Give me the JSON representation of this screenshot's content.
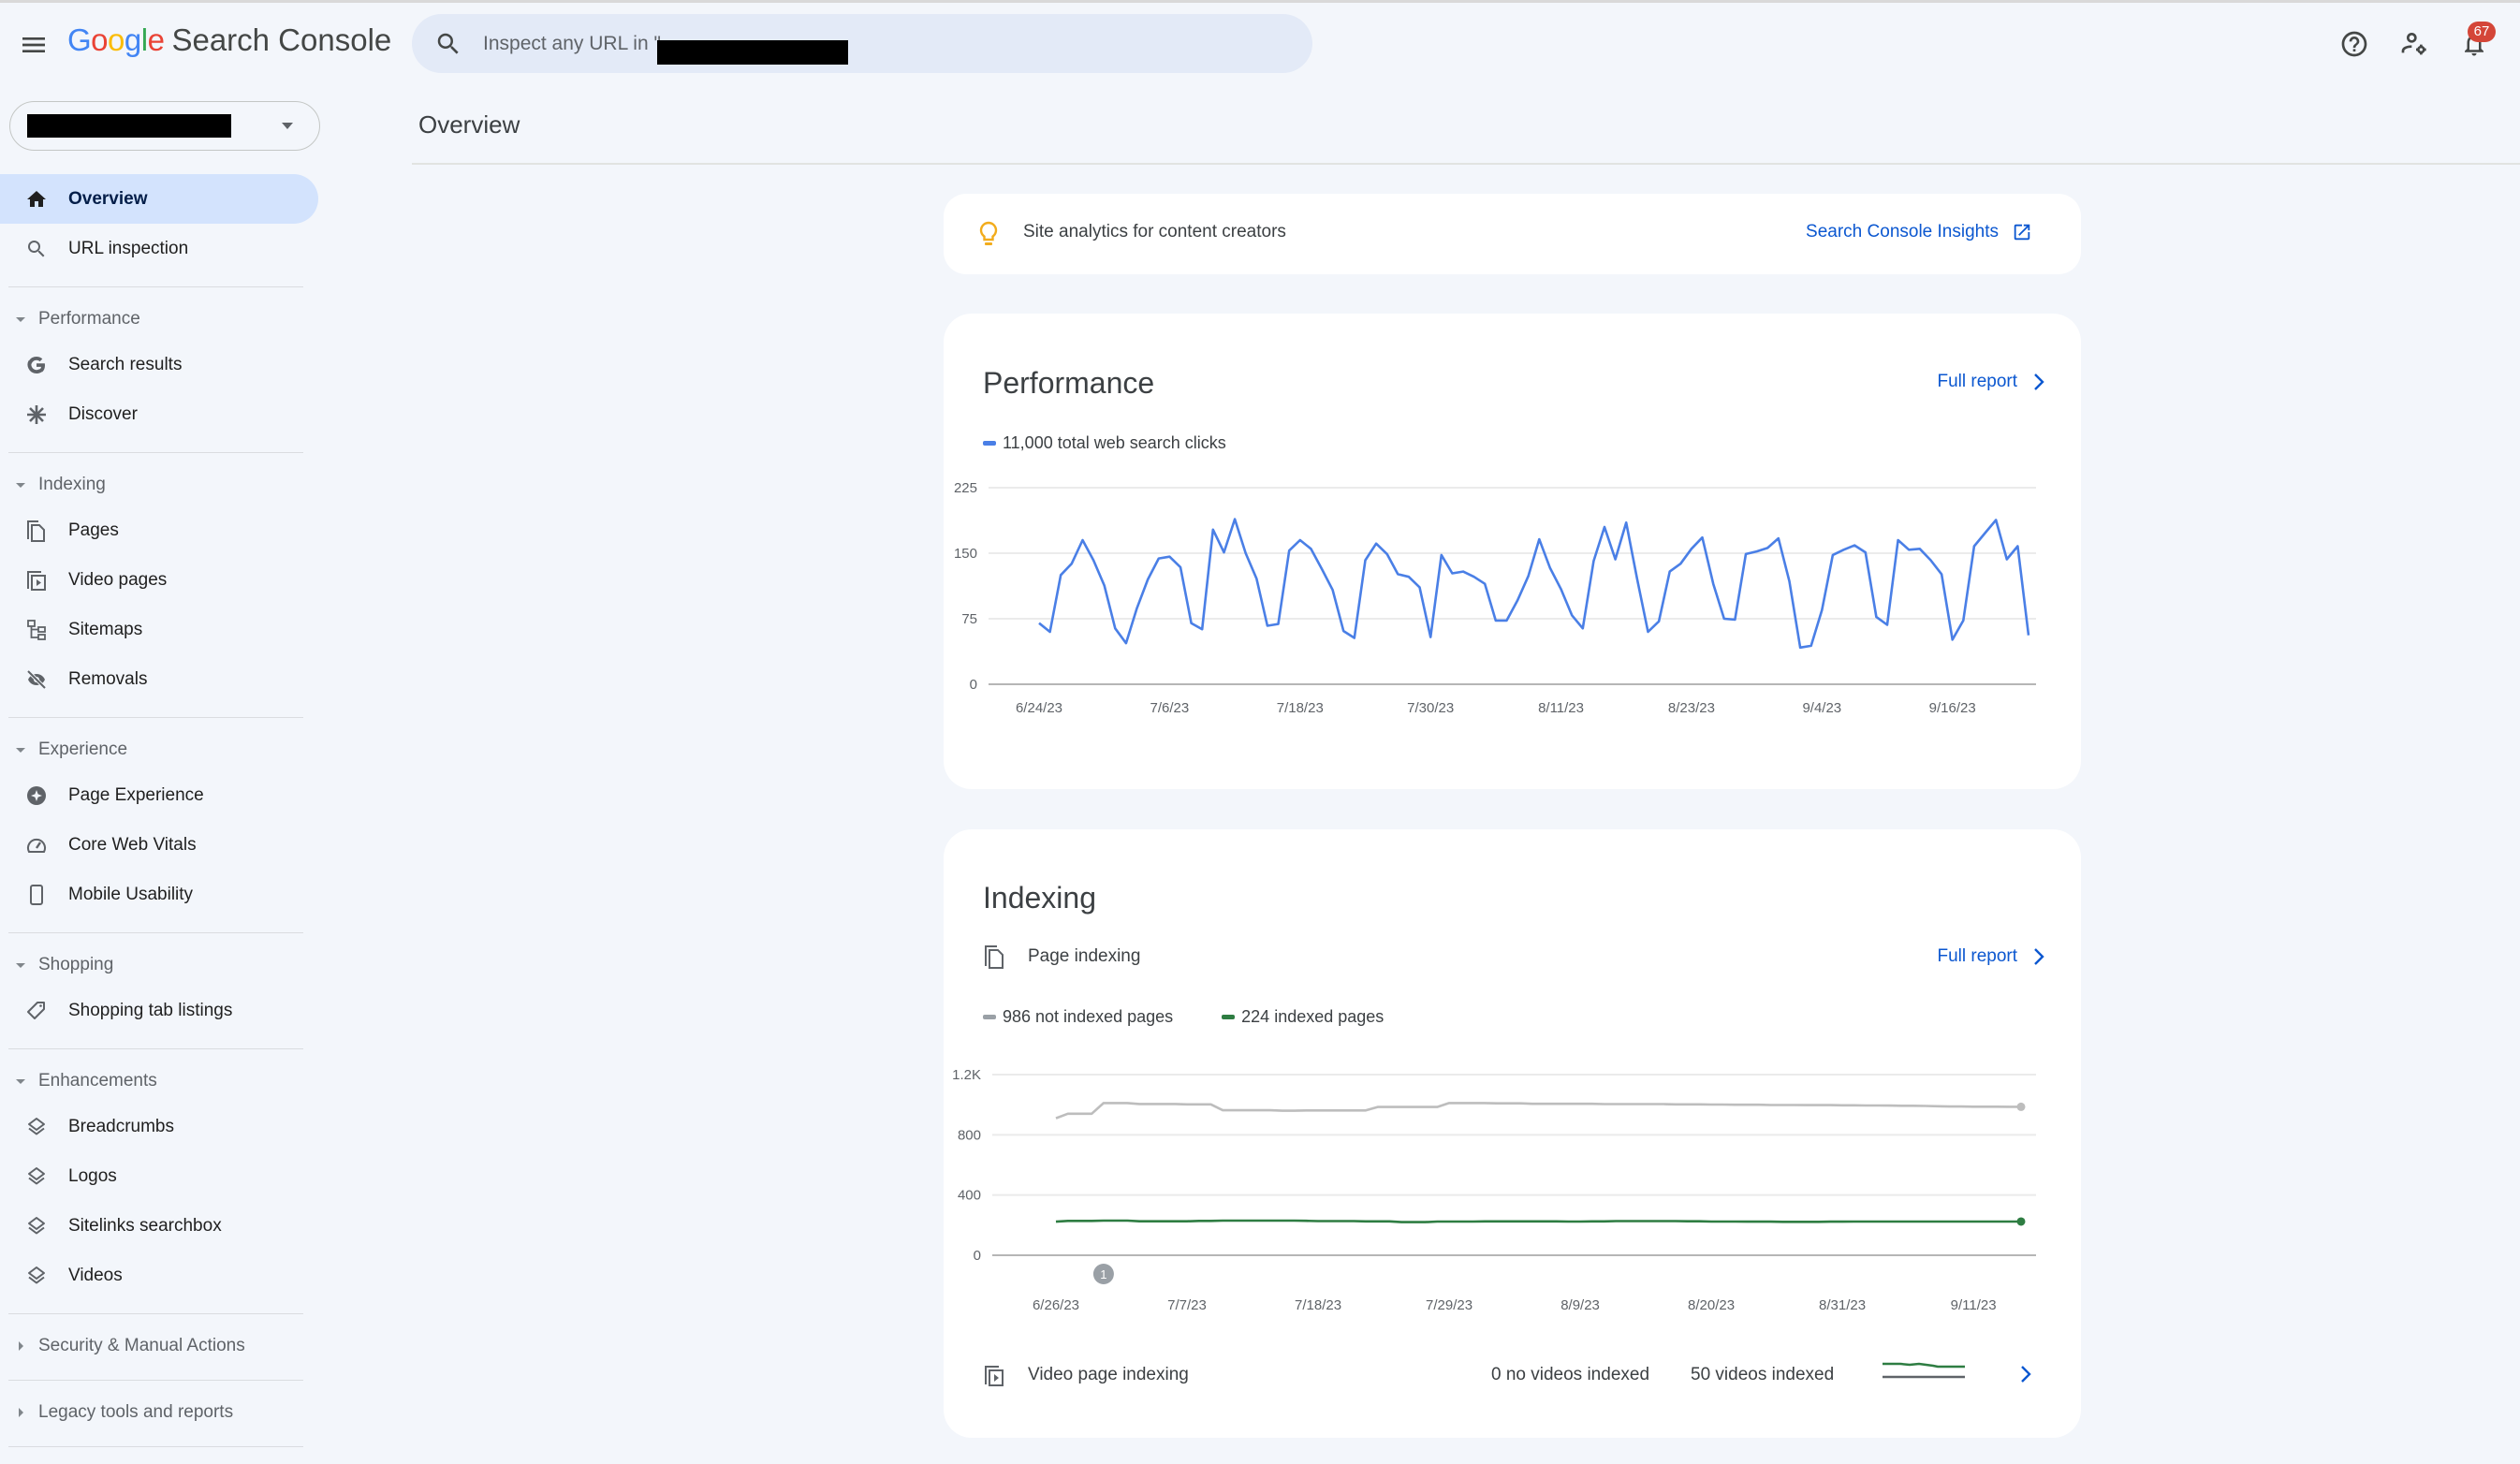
{
  "app": {
    "logo_google": [
      "G",
      "o",
      "o",
      "g",
      "l",
      "e"
    ],
    "logo_colors": [
      "#4285f4",
      "#ea4335",
      "#fbbc05",
      "#4285f4",
      "#34a853",
      "#ea4335"
    ],
    "product_name": "Search Console",
    "search_placeholder": "Inspect any URL in \"",
    "notification_count": "67",
    "accent_color": "#0b57d0"
  },
  "page": {
    "title": "Overview"
  },
  "sidebar": {
    "top_items": [
      {
        "label": "Overview",
        "icon": "home-icon",
        "active": true
      },
      {
        "label": "URL inspection",
        "icon": "search-icon",
        "active": false
      }
    ],
    "sections": [
      {
        "label": "Performance",
        "expanded": true,
        "items": [
          {
            "label": "Search results",
            "icon": "google-g-icon"
          },
          {
            "label": "Discover",
            "icon": "asterisk-icon"
          }
        ]
      },
      {
        "label": "Indexing",
        "expanded": true,
        "items": [
          {
            "label": "Pages",
            "icon": "pages-icon"
          },
          {
            "label": "Video pages",
            "icon": "video-pages-icon"
          },
          {
            "label": "Sitemaps",
            "icon": "sitemap-icon"
          },
          {
            "label": "Removals",
            "icon": "eye-off-icon"
          }
        ]
      },
      {
        "label": "Experience",
        "expanded": true,
        "items": [
          {
            "label": "Page Experience",
            "icon": "page-experience-icon"
          },
          {
            "label": "Core Web Vitals",
            "icon": "gauge-icon"
          },
          {
            "label": "Mobile Usability",
            "icon": "smartphone-icon"
          }
        ]
      },
      {
        "label": "Shopping",
        "expanded": true,
        "items": [
          {
            "label": "Shopping tab listings",
            "icon": "tag-icon"
          }
        ]
      },
      {
        "label": "Enhancements",
        "expanded": true,
        "items": [
          {
            "label": "Breadcrumbs",
            "icon": "layers-icon"
          },
          {
            "label": "Logos",
            "icon": "layers-icon"
          },
          {
            "label": "Sitelinks searchbox",
            "icon": "layers-icon"
          },
          {
            "label": "Videos",
            "icon": "layers-icon"
          }
        ]
      },
      {
        "label": "Security & Manual Actions",
        "expanded": false,
        "items": []
      },
      {
        "label": "Legacy tools and reports",
        "expanded": false,
        "items": []
      }
    ]
  },
  "insights": {
    "text": "Site analytics for content creators",
    "link_label": "Search Console Insights"
  },
  "performance": {
    "title": "Performance",
    "full_report_label": "Full report",
    "legend": "11,000 total web search clicks"
  },
  "indexing": {
    "title": "Indexing",
    "page_indexing_label": "Page indexing",
    "full_report_label": "Full report",
    "legend_not_indexed": "986 not indexed pages",
    "legend_indexed": "224 indexed pages",
    "annotation_label": "1",
    "video_label": "Video page indexing",
    "video_no_indexed": "0 no videos indexed",
    "video_indexed": "50 videos indexed"
  },
  "chart_data": [
    {
      "type": "line",
      "title": "Performance",
      "legend": [
        "11,000 total web search clicks"
      ],
      "series_color": "#4a7fe6",
      "ylim": [
        0,
        225
      ],
      "yticks": [
        0,
        75,
        150,
        225
      ],
      "ytick_labels": [
        "0",
        "75",
        "150",
        "225"
      ],
      "start_date": "6/24/23",
      "xtick_labels": [
        "6/24/23",
        "7/6/23",
        "7/18/23",
        "7/30/23",
        "8/11/23",
        "8/23/23",
        "9/4/23",
        "9/16/23"
      ],
      "xtick_day_index": [
        0,
        12,
        24,
        36,
        48,
        60,
        72,
        84
      ],
      "grid": true,
      "series": [
        {
          "name": "Clicks",
          "values": [
            70,
            60,
            125,
            138,
            165,
            142,
            113,
            64,
            47,
            87,
            120,
            144,
            146,
            134,
            70,
            63,
            177,
            151,
            189,
            150,
            121,
            67,
            69,
            153,
            165,
            155,
            132,
            108,
            61,
            53,
            142,
            161,
            149,
            126,
            123,
            111,
            54,
            148,
            127,
            129,
            123,
            115,
            73,
            73,
            96,
            124,
            166,
            133,
            109,
            79,
            64,
            141,
            180,
            143,
            185,
            121,
            60,
            72,
            129,
            138,
            155,
            168,
            115,
            75,
            74,
            149,
            152,
            156,
            167,
            118,
            42,
            44,
            85,
            148,
            154,
            159,
            151,
            77,
            68,
            165,
            154,
            155,
            142,
            126,
            51,
            73,
            158,
            173,
            188,
            143,
            158,
            56
          ]
        }
      ]
    },
    {
      "type": "line",
      "title": "Page indexing",
      "legend": [
        "986 not indexed pages",
        "224 indexed pages"
      ],
      "ylim": [
        0,
        1200
      ],
      "yticks": [
        0,
        400,
        800,
        1200
      ],
      "ytick_labels": [
        "0",
        "400",
        "800",
        "1.2K"
      ],
      "start_date": "6/26/23",
      "xtick_labels": [
        "6/26/23",
        "7/7/23",
        "7/18/23",
        "7/29/23",
        "8/9/23",
        "8/20/23",
        "8/31/23",
        "9/11/23"
      ],
      "xtick_day_index": [
        0,
        11,
        22,
        33,
        44,
        55,
        66,
        77
      ],
      "annotations": [
        {
          "day_index": 4,
          "label": "1"
        }
      ],
      "grid": true,
      "series": [
        {
          "name": "Not indexed",
          "color": "#bdbdbd",
          "values": [
            910,
            940,
            940,
            940,
            1011,
            1011,
            1011,
            1005,
            1005,
            1005,
            1005,
            1002,
            1002,
            1002,
            963,
            963,
            963,
            963,
            963,
            960,
            960,
            962,
            962,
            962,
            962,
            962,
            962,
            985,
            985,
            985,
            985,
            985,
            985,
            1011,
            1011,
            1011,
            1011,
            1009,
            1009,
            1009,
            1006,
            1006,
            1006,
            1006,
            1006,
            1006,
            1004,
            1004,
            1004,
            1004,
            1004,
            1004,
            1002,
            1002,
            1002,
            1001,
            1001,
            1000,
            1000,
            1000,
            998,
            998,
            998,
            997,
            997,
            997,
            996,
            996,
            995,
            995,
            994,
            993,
            993,
            992,
            990,
            988,
            988,
            987,
            987,
            987,
            986,
            986
          ]
        },
        {
          "name": "Indexed",
          "color": "#2e7d42",
          "values": [
            223,
            228,
            228,
            228,
            230,
            230,
            230,
            226,
            226,
            226,
            226,
            226,
            228,
            228,
            230,
            230,
            230,
            230,
            230,
            230,
            230,
            229,
            227,
            227,
            227,
            227,
            225,
            225,
            225,
            220,
            220,
            220,
            224,
            224,
            224,
            224,
            225,
            225,
            225,
            225,
            225,
            225,
            225,
            224,
            224,
            225,
            225,
            227,
            227,
            227,
            227,
            227,
            227,
            226,
            226,
            224,
            224,
            224,
            223,
            223,
            223,
            222,
            222,
            222,
            222,
            223,
            223,
            224,
            224,
            224,
            224,
            224,
            224,
            224,
            224,
            224,
            224,
            224,
            224,
            224,
            224,
            224
          ]
        }
      ]
    }
  ]
}
